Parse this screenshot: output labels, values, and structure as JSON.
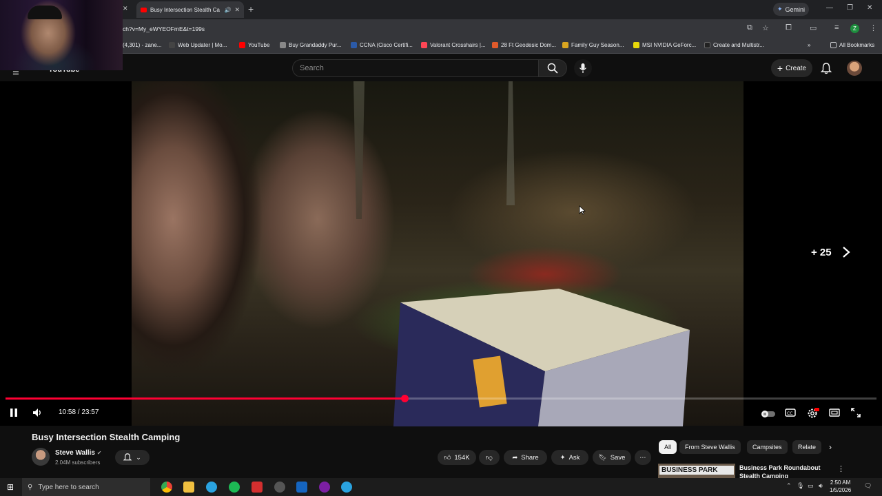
{
  "browser": {
    "tab_title": "Busy Intersection Stealth Ca",
    "url": "ch?v=My_eWYEOFmE&t=199s",
    "gemini_label": "Gemini",
    "profile_initial": "Z",
    "bookmarks": [
      {
        "label": "(4,301) - zane...",
        "color": "#2d2d2d"
      },
      {
        "label": "Web Updater | Mo...",
        "color": "#444"
      },
      {
        "label": "YouTube",
        "color": "#ff0000"
      },
      {
        "label": "Buy Grandaddy Pur...",
        "color": "#888"
      },
      {
        "label": "CCNA (Cisco Certifi...",
        "color": "#2b5aa8"
      },
      {
        "label": "Valorant Crosshairs |...",
        "color": "#ff4655"
      },
      {
        "label": "28 Ft Geodesic Dom...",
        "color": "#e05a2b"
      },
      {
        "label": "Family Guy Season...",
        "color": "#d9a520"
      },
      {
        "label": "MSI NVIDIA GeForc...",
        "color": "#e8d80a"
      },
      {
        "label": "Create and Multistr...",
        "color": "#222"
      }
    ],
    "all_bookmarks": "All Bookmarks"
  },
  "youtube": {
    "logo_text": "YouTube",
    "search_placeholder": "Search",
    "create_label": "Create"
  },
  "player": {
    "current_time": "10:58",
    "duration": "23:57",
    "time_display": "10:58 / 23:57",
    "progress_fraction": 0.458,
    "skip_overlay": "+ 25"
  },
  "video": {
    "title": "Busy Intersection Stealth Camping",
    "channel": "Steve Wallis",
    "subscribers": "2.04M subscribers",
    "likes": "154K",
    "share_label": "Share",
    "ask_label": "Ask",
    "save_label": "Save"
  },
  "sidebar": {
    "chips": [
      "All",
      "From Steve Wallis",
      "Campsites",
      "Relate"
    ],
    "rec_thumb_text": "BUSINESS PARK",
    "rec_title": "Business Park Roundabout Stealth Camping"
  },
  "taskbar": {
    "search_placeholder": "Type here to search",
    "time": "2:50 AM",
    "date": "1/5/2026"
  }
}
